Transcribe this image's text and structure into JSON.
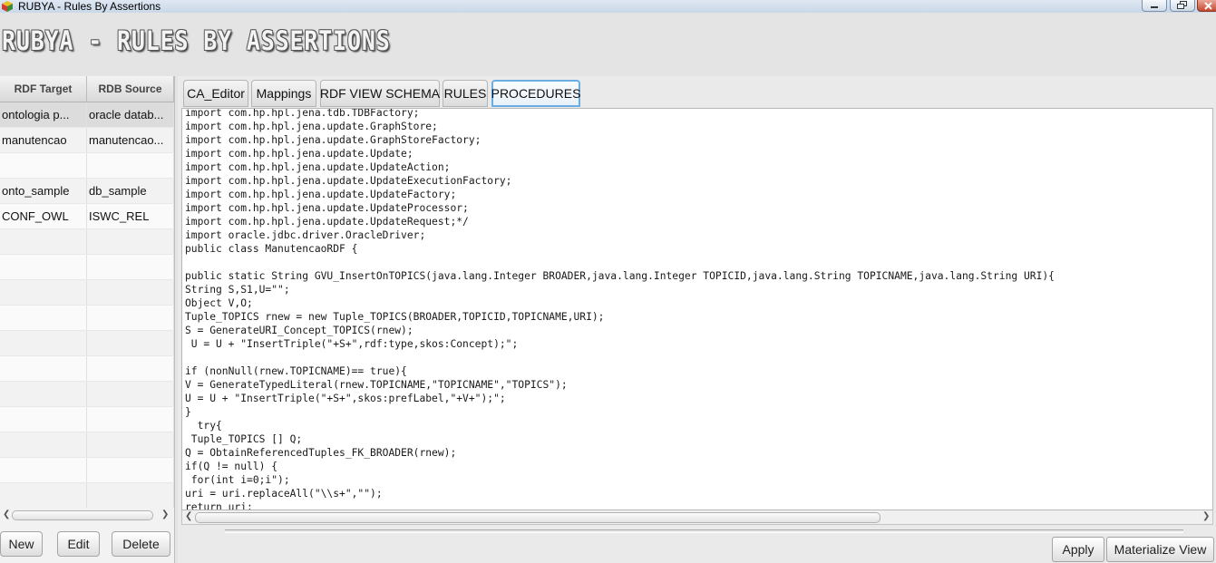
{
  "window": {
    "title": "RUBYA - Rules By Assertions",
    "logo_text": "RUBYA - RULES BY ASSERTIONS"
  },
  "left_grid": {
    "columns": [
      "RDF Target",
      "RDB Source"
    ],
    "rows": [
      [
        "ontologia p...",
        "oracle datab..."
      ],
      [
        "manutencao",
        "manutencao..."
      ],
      [
        "",
        ""
      ],
      [
        "onto_sample",
        "db_sample"
      ],
      [
        "CONF_OWL",
        "ISWC_REL"
      ],
      [
        "",
        ""
      ],
      [
        "",
        ""
      ],
      [
        "",
        ""
      ],
      [
        "",
        ""
      ],
      [
        "",
        ""
      ],
      [
        "",
        ""
      ],
      [
        "",
        ""
      ],
      [
        "",
        ""
      ],
      [
        "",
        ""
      ],
      [
        "",
        ""
      ],
      [
        "",
        ""
      ]
    ],
    "buttons": {
      "new": "New",
      "edit": "Edit",
      "delete": "Delete"
    }
  },
  "tabs": [
    {
      "label": "CA_Editor"
    },
    {
      "label": "Mappings"
    },
    {
      "label": "RDF VIEW SCHEMA"
    },
    {
      "label": "RULES"
    },
    {
      "label": "PROCEDURES",
      "active": true
    }
  ],
  "editor": {
    "lines": [
      "import com.hp.hpl.jena.tdb.TDBFactory;",
      "import com.hp.hpl.jena.update.GraphStore;",
      "import com.hp.hpl.jena.update.GraphStoreFactory;",
      "import com.hp.hpl.jena.update.Update;",
      "import com.hp.hpl.jena.update.UpdateAction;",
      "import com.hp.hpl.jena.update.UpdateExecutionFactory;",
      "import com.hp.hpl.jena.update.UpdateFactory;",
      "import com.hp.hpl.jena.update.UpdateProcessor;",
      "import com.hp.hpl.jena.update.UpdateRequest;*/",
      "import oracle.jdbc.driver.OracleDriver;",
      "public class ManutencaoRDF {",
      "",
      "public static String GVU_InsertOnTOPICS(java.lang.Integer BROADER,java.lang.Integer TOPICID,java.lang.String TOPICNAME,java.lang.String URI){",
      "String S,S1,U=\"\";",
      "Object V,O;",
      "Tuple_TOPICS rnew = new Tuple_TOPICS(BROADER,TOPICID,TOPICNAME,URI);",
      "S = GenerateURI_Concept_TOPICS(rnew);",
      " U = U + \"InsertTriple(\"+S+\",rdf:type,skos:Concept);\";",
      "",
      "if (nonNull(rnew.TOPICNAME)== true){",
      "V = GenerateTypedLiteral(rnew.TOPICNAME,\"TOPICNAME\",\"TOPICS\");",
      "U = U + \"InsertTriple(\"+S+\",skos:prefLabel,\"+V+\");\";",
      "}",
      "  try{",
      " Tuple_TOPICS [] Q;",
      "Q = ObtainReferencedTuples_FK_BROADER(rnew);",
      "if(Q != null) {",
      " for(int i=0;i\");",
      "uri = uri.replaceAll(\"\\\\s+\",\"\");",
      "return uri;"
    ]
  },
  "bottom_buttons": {
    "apply": "Apply",
    "materialize": "Materialize View"
  }
}
